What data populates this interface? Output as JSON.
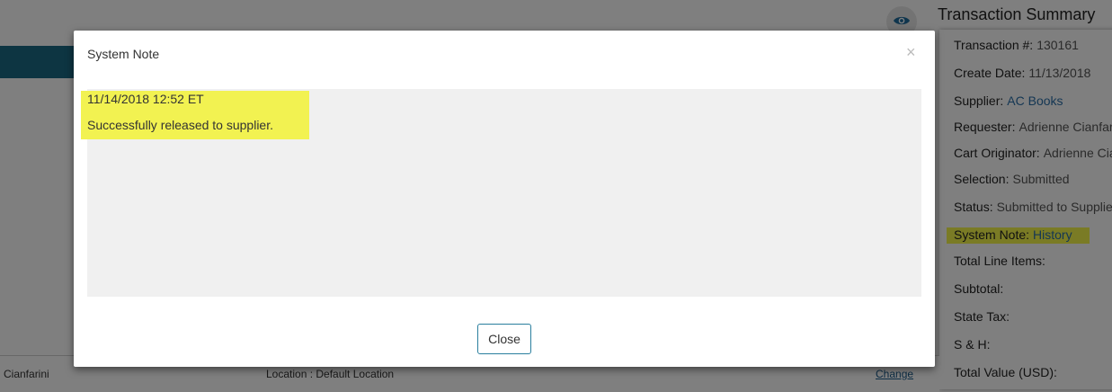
{
  "background": {
    "footer": {
      "buyer_name": "Cianfarini",
      "location": "Location : Default Location",
      "change_link": "Change"
    }
  },
  "summary": {
    "title": "Transaction Summary",
    "rows": [
      {
        "label": "Transaction #:",
        "value": "130161"
      },
      {
        "label": "Create Date:",
        "value": "11/13/2018"
      },
      {
        "label": "Supplier:",
        "value": "AC Books"
      },
      {
        "label": "Requester:",
        "value": "Adrienne Cianfarini"
      },
      {
        "label": "Cart Originator:",
        "value": "Adrienne Cianfarini"
      },
      {
        "label": "Selection:",
        "value": "Submitted"
      },
      {
        "label": "Status:",
        "value": "Submitted to Supplier"
      },
      {
        "label": "System Note:",
        "value": "History"
      },
      {
        "label": "Total Line Items:",
        "value": ""
      },
      {
        "label": "Subtotal:",
        "value": ""
      },
      {
        "label": "State Tax:",
        "value": ""
      },
      {
        "label": "S & H:",
        "value": ""
      },
      {
        "label": "Total Value (USD):",
        "value": ""
      }
    ]
  },
  "modal": {
    "title": "System Note",
    "close_x": "×",
    "note": {
      "timestamp": "11/14/2018 12:52 ET",
      "message": "Successfully released to supplier."
    },
    "close_button": "Close"
  },
  "colors": {
    "highlight": "#f2f251",
    "link": "#2a6fa8",
    "button_border": "#2a7f9e"
  },
  "icons": [
    "eye-icon",
    "close-icon"
  ]
}
